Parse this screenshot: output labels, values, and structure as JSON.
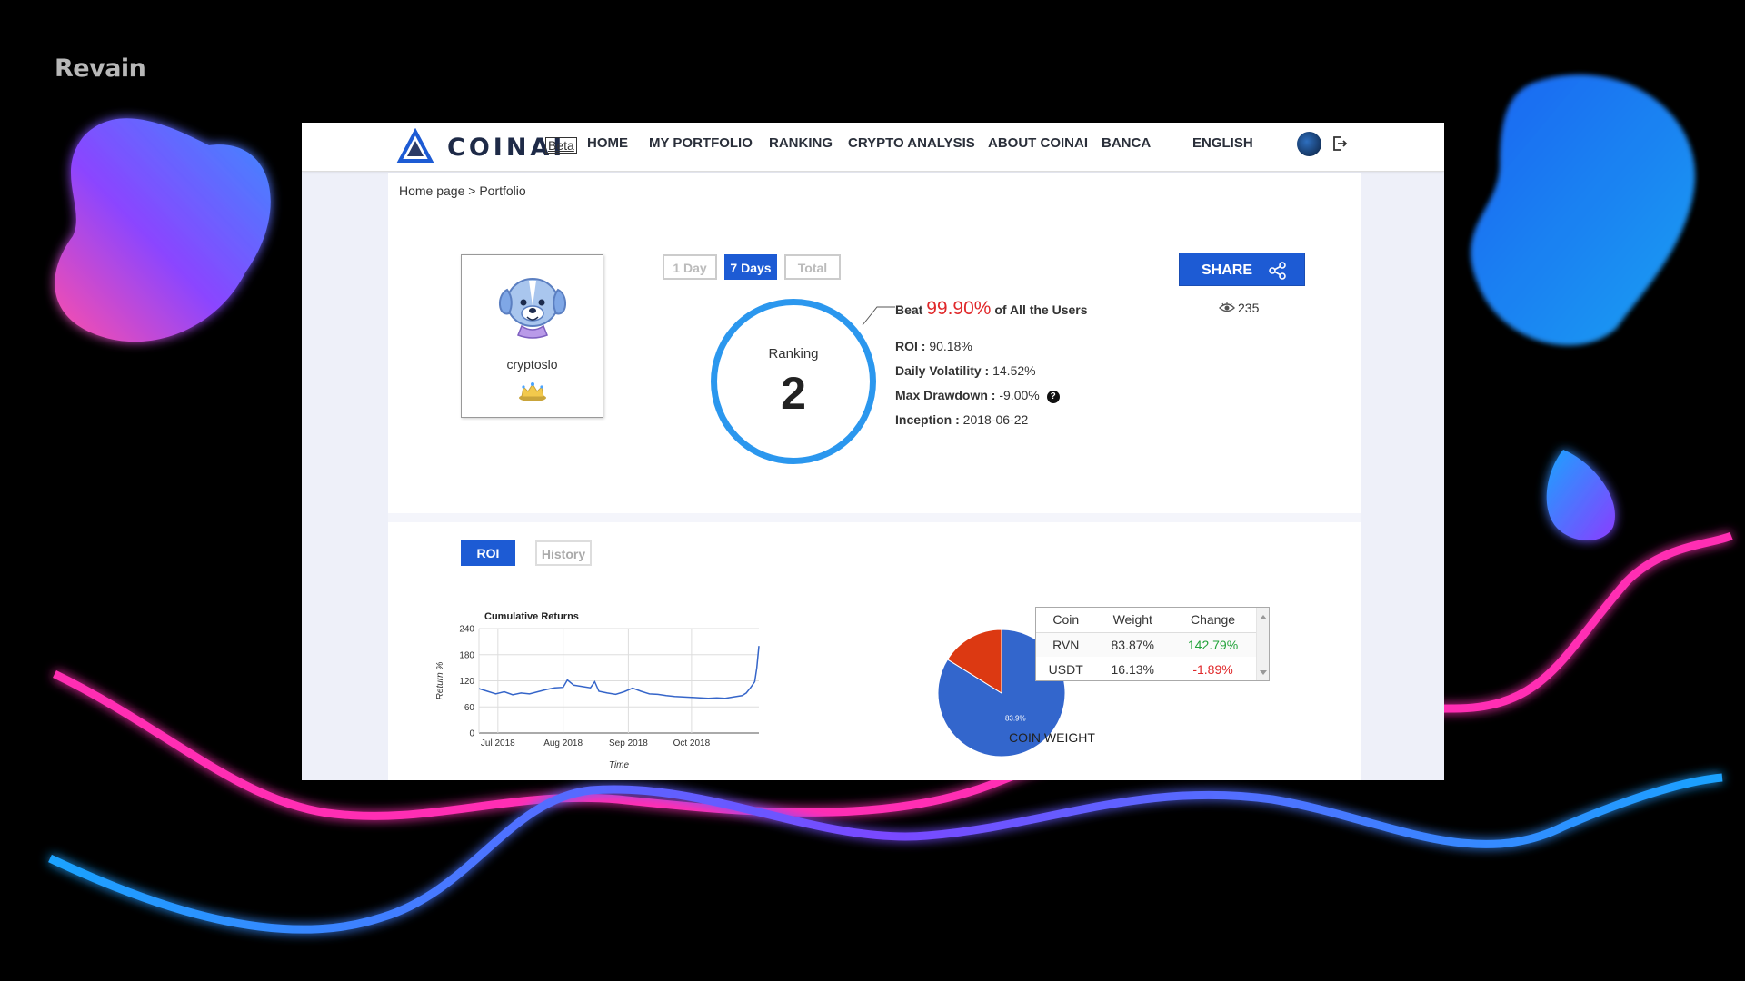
{
  "watermark": "Revain",
  "header": {
    "logo_text": "COINAI",
    "beta_label": "Beta",
    "nav": [
      "HOME",
      "MY PORTFOLIO",
      "RANKING",
      "CRYPTO ANALYSIS",
      "ABOUT COINAI",
      "BANCA",
      "ENGLISH"
    ]
  },
  "breadcrumb": "Home page > Portfolio",
  "profile": {
    "username": "cryptoslo"
  },
  "periods": {
    "day": "1 Day",
    "week": "7 Days",
    "total": "Total",
    "selected": "7 Days"
  },
  "ranking": {
    "label": "Ranking",
    "value": "2"
  },
  "beat": {
    "prefix": "Beat ",
    "percent": "99.90%",
    "suffix": " of All the Users"
  },
  "stats": {
    "roi_label": "ROI :",
    "roi_value": " 90.18%",
    "volatility_label": "Daily Volatility :",
    "volatility_value": " 14.52%",
    "drawdown_label": "Max Drawdown :",
    "drawdown_value": " -9.00%",
    "inception_label": "Inception :",
    "inception_value": " 2018-06-22"
  },
  "share": {
    "label": "SHARE",
    "views": "235"
  },
  "tabs": {
    "roi": "ROI",
    "history": "History"
  },
  "chart_data": [
    {
      "type": "line",
      "title": "Cumulative Returns",
      "xlabel": "Time",
      "ylabel": "Return %",
      "ylim": [
        0,
        240
      ],
      "yticks": [
        0,
        60,
        120,
        180,
        240
      ],
      "xticks": [
        "Jul 2018",
        "Aug 2018",
        "Sep 2018",
        "Oct 2018"
      ],
      "grid": true,
      "series": [
        {
          "color": "#3565c9",
          "x": [
            "2018-06-22",
            "2018-06-26",
            "2018-06-30",
            "2018-07-04",
            "2018-07-08",
            "2018-07-12",
            "2018-07-16",
            "2018-07-20",
            "2018-07-24",
            "2018-07-28",
            "2018-08-01",
            "2018-08-03",
            "2018-08-06",
            "2018-08-10",
            "2018-08-14",
            "2018-08-16",
            "2018-08-18",
            "2018-08-22",
            "2018-08-26",
            "2018-08-30",
            "2018-09-03",
            "2018-09-07",
            "2018-09-11",
            "2018-09-15",
            "2018-09-19",
            "2018-09-23",
            "2018-09-27",
            "2018-10-01",
            "2018-10-05",
            "2018-10-09",
            "2018-10-13",
            "2018-10-17",
            "2018-10-21",
            "2018-10-25",
            "2018-10-27",
            "2018-10-29",
            "2018-10-31",
            "2018-11-01",
            "2018-11-02"
          ],
          "y": [
            102,
            96,
            90,
            95,
            88,
            92,
            90,
            95,
            100,
            104,
            105,
            122,
            110,
            107,
            104,
            118,
            96,
            92,
            89,
            95,
            103,
            96,
            90,
            89,
            86,
            84,
            83,
            82,
            81,
            80,
            81,
            80,
            83,
            86,
            92,
            104,
            118,
            150,
            200
          ]
        }
      ]
    },
    {
      "type": "pie",
      "title": "COIN WEIGHT",
      "slices": [
        {
          "label": "RVN",
          "value": 83.87,
          "color": "#3366cc",
          "display": "83.9%"
        },
        {
          "label": "USDT",
          "value": 16.13,
          "color": "#dc3912"
        }
      ]
    }
  ],
  "coin_table": {
    "headers": [
      "Coin",
      "Weight",
      "Change"
    ],
    "rows": [
      {
        "coin": "RVN",
        "weight": "83.87%",
        "change": "142.79%",
        "change_color": "#22a33a"
      },
      {
        "coin": "USDT",
        "weight": "16.13%",
        "change": "-1.89%",
        "change_color": "#e0282a"
      }
    ]
  }
}
